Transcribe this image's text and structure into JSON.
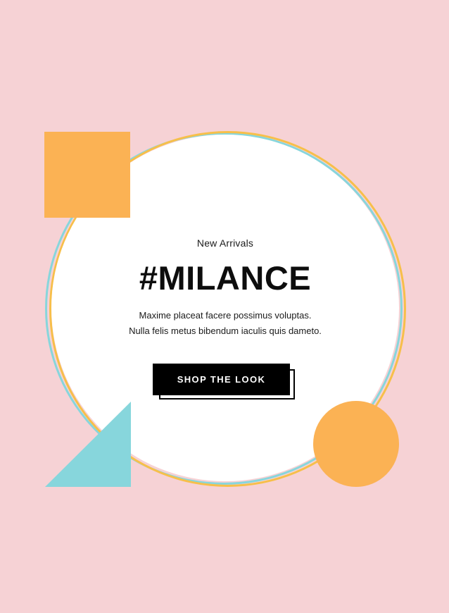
{
  "hero": {
    "eyebrow": "New Arrivals",
    "title": "#MILANCE",
    "description_lines": [
      "Maxime placeat facere possimus voluptas.",
      "Nulla felis metus bibendum iaculis quis dameto."
    ],
    "cta_label": "SHOP THE LOOK"
  },
  "colors": {
    "background": "#f6d2d5",
    "accent_orange": "#fbb254",
    "accent_teal": "#87d6dc",
    "ring_yellow": "#f7bf4a",
    "text_dark": "#0d0d0d"
  },
  "decorations": [
    "square-shape",
    "triangle-shape",
    "circle-shape",
    "double-ring"
  ]
}
